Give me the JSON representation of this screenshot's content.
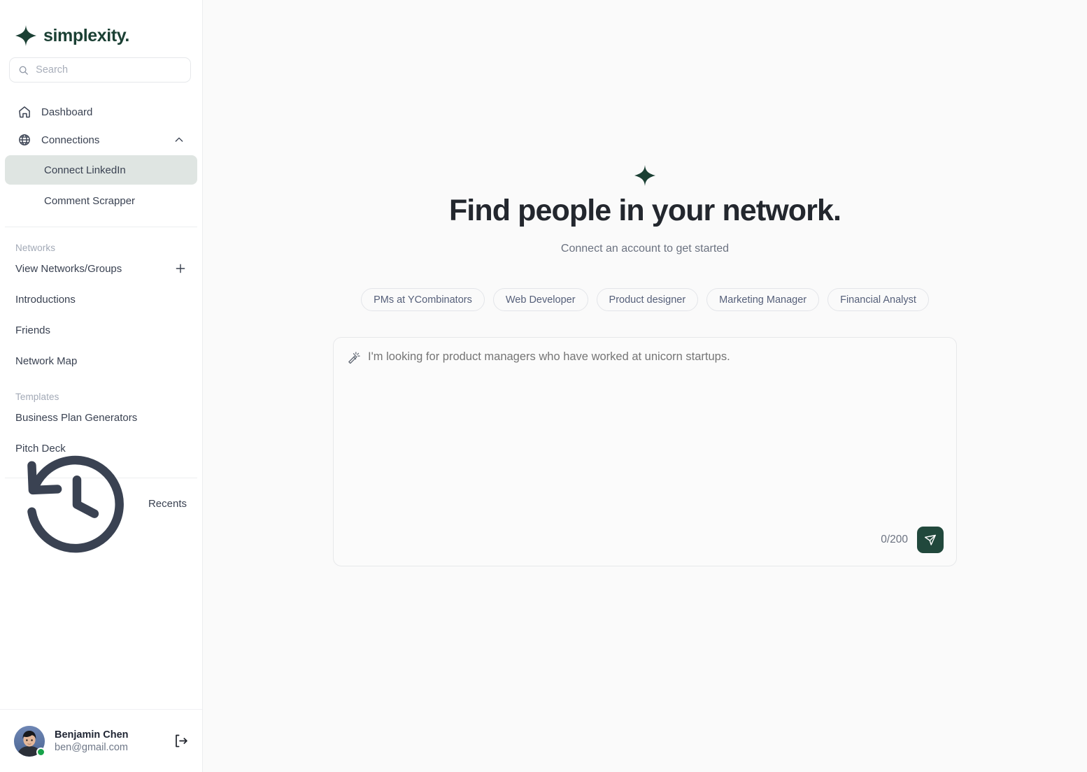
{
  "brand": {
    "name": "simplexity.",
    "logo_icon": "sparkle-star-icon",
    "color": "#1B4034"
  },
  "search": {
    "placeholder": "Search",
    "value": "",
    "icon": "search-icon"
  },
  "sidebar": {
    "nav": [
      {
        "label": "Dashboard",
        "icon": "home-icon"
      },
      {
        "label": "Connections",
        "icon": "globe-icon",
        "chevron": "chevron-up-icon",
        "expanded": true
      }
    ],
    "connections_children": [
      {
        "label": "Connect LinkedIn",
        "active": true
      },
      {
        "label": "Comment Scrapper",
        "active": false
      }
    ],
    "sections": [
      {
        "label": "Networks",
        "items": [
          {
            "label": "View Networks/Groups",
            "trailing_icon": "plus-icon"
          },
          {
            "label": "Introductions"
          },
          {
            "label": "Friends"
          },
          {
            "label": "Network Map"
          }
        ]
      },
      {
        "label": "Templates",
        "items": [
          {
            "label": "Business Plan Generators"
          },
          {
            "label": "Pitch Deck"
          }
        ]
      }
    ],
    "recents": {
      "label": "Recents",
      "icon": "history-clock-icon"
    }
  },
  "user": {
    "name": "Benjamin Chen",
    "email": "ben@gmail.com",
    "status": "online",
    "status_color": "#17A34A",
    "avatar_icon": "user-avatar-photo",
    "logout_icon": "logout-icon"
  },
  "main": {
    "hero_icon": "sparkle-star-icon",
    "title": "Find people in your network.",
    "subtitle": "Connect an account to get started",
    "chips": [
      "PMs at YCombinators",
      "Web Developer",
      "Product designer",
      "Marketing Manager",
      "Financial Analyst"
    ],
    "prompt": {
      "icon": "magic-wand-icon",
      "placeholder": "I'm looking for product managers who have worked at unicorn startups.",
      "value": "",
      "counter": "0/200",
      "send_icon": "send-paper-plane-icon",
      "send_color": "#21483C"
    }
  }
}
